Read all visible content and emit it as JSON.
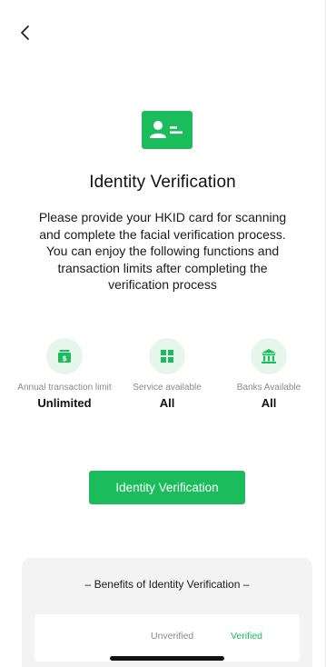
{
  "colors": {
    "accent": "#1ABC5C",
    "accent_light": "#E7F6EC",
    "muted_text": "#8A8A8A",
    "panel_bg": "#F3F3F3"
  },
  "nav": {
    "back_icon": "chevron-left-icon"
  },
  "hero": {
    "icon": "id-card-icon",
    "title": "Identity Verification",
    "description": "Please provide your HKID card for scanning and complete the facial verification process. You can enjoy the following functions and transaction limits after completing the verification process"
  },
  "features": [
    {
      "icon": "money-icon",
      "label": "Annual transaction limit",
      "value": "Unlimited"
    },
    {
      "icon": "grid-icon",
      "label": "Service available",
      "value": "All"
    },
    {
      "icon": "bank-icon",
      "label": "Banks Available",
      "value": "All"
    }
  ],
  "actions": {
    "verify_button": "Identity Verification"
  },
  "benefits": {
    "title": "– Benefits of Identity Verification –",
    "columns": {
      "unverified": "Unverified",
      "verified": "Verified"
    }
  }
}
